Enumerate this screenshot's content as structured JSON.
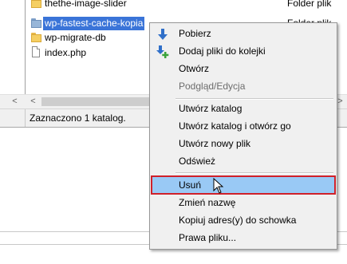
{
  "file_list": {
    "rows": [
      {
        "name": "thethe-image-slider",
        "type": "Folder plik",
        "icon": "folder-icon"
      },
      {
        "name": "wp-fastest-cache-kopia",
        "type": "Folder plik",
        "icon": "folder-icon",
        "selected": true
      },
      {
        "name": "wp-migrate-db",
        "type": "",
        "icon": "folder-icon"
      },
      {
        "name": "index.php",
        "type": "",
        "icon": "php-file-icon"
      }
    ]
  },
  "scrollbar": {
    "left_arrow": "<",
    "right_arrow": ">"
  },
  "status_bar": {
    "text": "Zaznaczono 1 katalog."
  },
  "context_menu": {
    "items": [
      {
        "label": "Pobierz",
        "icon": "download-arrow-icon"
      },
      {
        "label": "Dodaj pliki do kolejki",
        "icon": "add-to-queue-icon"
      },
      {
        "label": "Otwórz"
      },
      {
        "label": "Podgląd/Edycja",
        "disabled": true
      },
      {
        "label": "Utwórz katalog"
      },
      {
        "label": "Utwórz katalog i otwórz go"
      },
      {
        "label": "Utwórz nowy plik"
      },
      {
        "label": "Odśwież"
      },
      {
        "label": "Usuń",
        "highlighted": true
      },
      {
        "label": "Zmień nazwę"
      },
      {
        "label": "Kopiuj adres(y) do schowka"
      },
      {
        "label": "Prawa pliku..."
      }
    ]
  },
  "colors": {
    "selection": "#3a74d8",
    "menu_hover": "#99c9f5",
    "highlight_outline": "#d0212a",
    "menu_background": "#f0f0f0",
    "folder": "#f5cf63"
  }
}
